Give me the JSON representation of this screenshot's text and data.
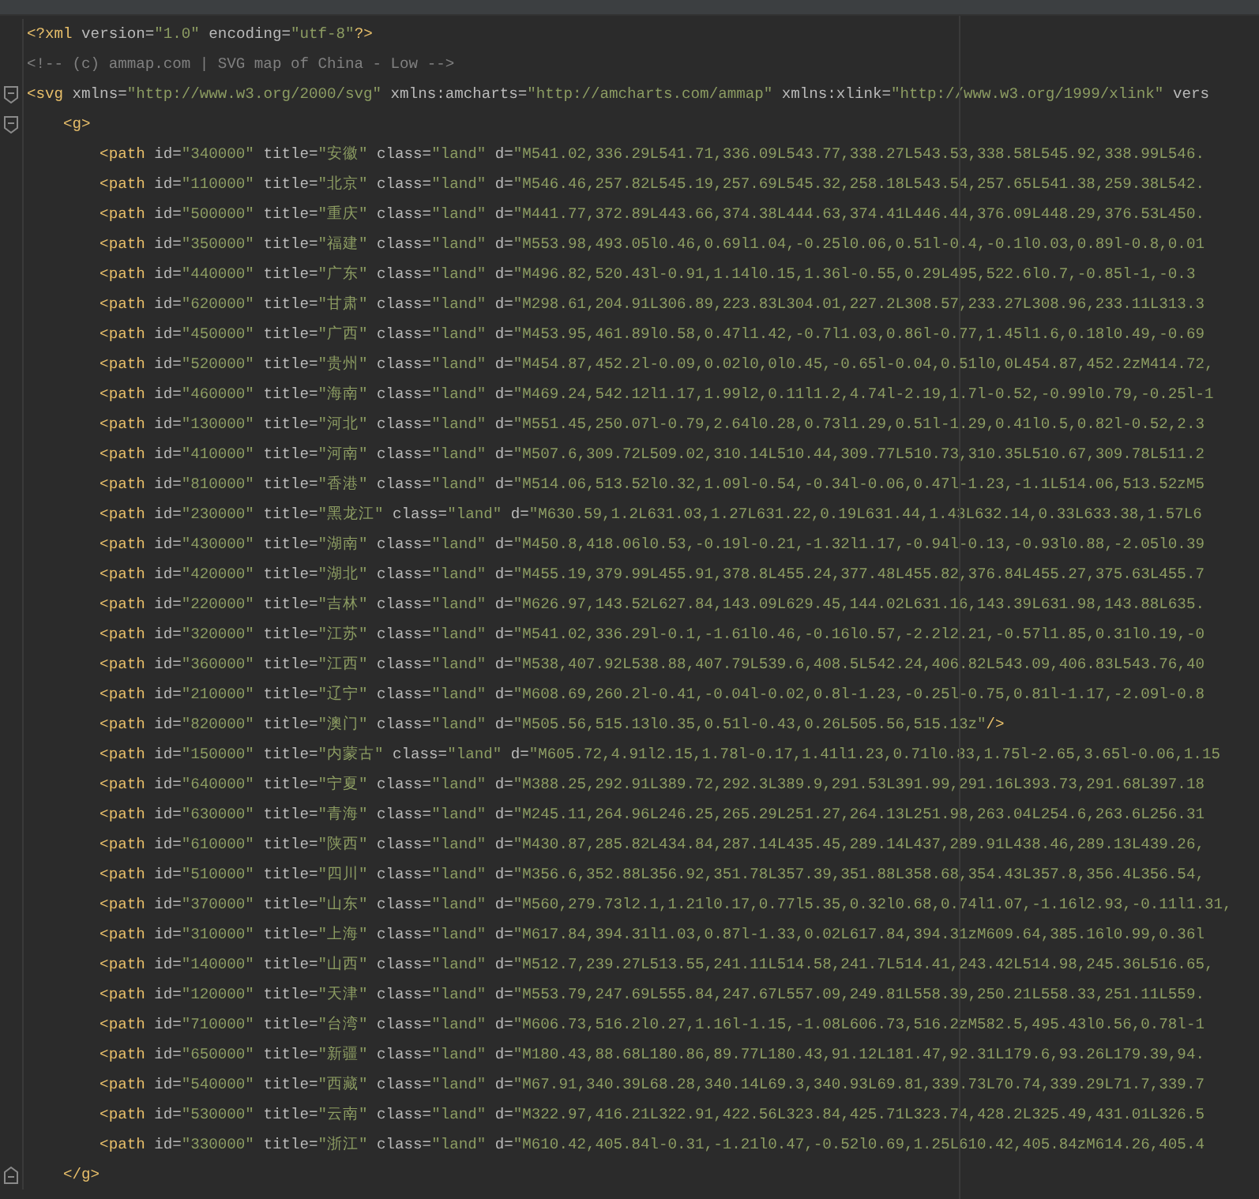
{
  "editor": {
    "lines": [
      {
        "tokens": [
          {
            "kind": "tag",
            "text": "<?xml"
          },
          {
            "kind": "attr",
            "text": " version="
          },
          {
            "kind": "value",
            "text": "\"1.0\""
          },
          {
            "kind": "attr",
            "text": " encoding="
          },
          {
            "kind": "value",
            "text": "\"utf-8\""
          },
          {
            "kind": "tag",
            "text": "?>"
          }
        ]
      },
      {
        "tokens": [
          {
            "kind": "comment",
            "text": "<!-- (c) ammap.com | SVG map of China - Low -->"
          }
        ]
      },
      {
        "kind": "fold_start",
        "tokens": [
          {
            "kind": "tag",
            "text": "<svg"
          },
          {
            "kind": "attr",
            "text": " xmlns="
          },
          {
            "kind": "value",
            "text": "\"http://www.w3.org/2000/svg\""
          },
          {
            "kind": "attr",
            "text": " xmlns:amcharts="
          },
          {
            "kind": "value",
            "text": "\"http://amcharts.com/ammap\""
          },
          {
            "kind": "attr",
            "text": " xmlns:xlink="
          },
          {
            "kind": "value",
            "text": "\"http://www.w3.org/1999/xlink\""
          },
          {
            "kind": "attr",
            "text": " vers"
          }
        ]
      },
      {
        "kind": "fold_start",
        "tokens": [
          {
            "kind": "tag",
            "text": "    <g>"
          }
        ]
      },
      {
        "tokens": [
          {
            "kind": "tag",
            "text": "        <path"
          },
          {
            "kind": "attr",
            "text": " id="
          },
          {
            "kind": "value",
            "text": "\"340000\""
          },
          {
            "kind": "attr",
            "text": " title="
          },
          {
            "kind": "value",
            "text": "\"安徽\""
          },
          {
            "kind": "attr",
            "text": " class="
          },
          {
            "kind": "value",
            "text": "\"land\""
          },
          {
            "kind": "attr",
            "text": " d="
          },
          {
            "kind": "value",
            "text": "\"M541.02,336.29L541.71,336.09L543.77,338.27L543.53,338.58L545.92,338.99L546."
          }
        ]
      },
      {
        "tokens": [
          {
            "kind": "tag",
            "text": "        <path"
          },
          {
            "kind": "attr",
            "text": " id="
          },
          {
            "kind": "value",
            "text": "\"110000\""
          },
          {
            "kind": "attr",
            "text": " title="
          },
          {
            "kind": "value",
            "text": "\"北京\""
          },
          {
            "kind": "attr",
            "text": " class="
          },
          {
            "kind": "value",
            "text": "\"land\""
          },
          {
            "kind": "attr",
            "text": " d="
          },
          {
            "kind": "value",
            "text": "\"M546.46,257.82L545.19,257.69L545.32,258.18L543.54,257.65L541.38,259.38L542."
          }
        ]
      },
      {
        "tokens": [
          {
            "kind": "tag",
            "text": "        <path"
          },
          {
            "kind": "attr",
            "text": " id="
          },
          {
            "kind": "value",
            "text": "\"500000\""
          },
          {
            "kind": "attr",
            "text": " title="
          },
          {
            "kind": "value",
            "text": "\"重庆\""
          },
          {
            "kind": "attr",
            "text": " class="
          },
          {
            "kind": "value",
            "text": "\"land\""
          },
          {
            "kind": "attr",
            "text": " d="
          },
          {
            "kind": "value",
            "text": "\"M441.77,372.89L443.66,374.38L444.63,374.41L446.44,376.09L448.29,376.53L450."
          }
        ]
      },
      {
        "tokens": [
          {
            "kind": "tag",
            "text": "        <path"
          },
          {
            "kind": "attr",
            "text": " id="
          },
          {
            "kind": "value",
            "text": "\"350000\""
          },
          {
            "kind": "attr",
            "text": " title="
          },
          {
            "kind": "value",
            "text": "\"福建\""
          },
          {
            "kind": "attr",
            "text": " class="
          },
          {
            "kind": "value",
            "text": "\"land\""
          },
          {
            "kind": "attr",
            "text": " d="
          },
          {
            "kind": "value",
            "text": "\"M553.98,493.05l0.46,0.69l1.04,-0.25l0.06,0.51l-0.4,-0.1l0.03,0.89l-0.8,0.01"
          }
        ]
      },
      {
        "tokens": [
          {
            "kind": "tag",
            "text": "        <path"
          },
          {
            "kind": "attr",
            "text": " id="
          },
          {
            "kind": "value",
            "text": "\"440000\""
          },
          {
            "kind": "attr",
            "text": " title="
          },
          {
            "kind": "value",
            "text": "\"广东\""
          },
          {
            "kind": "attr",
            "text": " class="
          },
          {
            "kind": "value",
            "text": "\"land\""
          },
          {
            "kind": "attr",
            "text": " d="
          },
          {
            "kind": "value",
            "text": "\"M496.82,520.43l-0.91,1.14l0.15,1.36l-0.55,0.29L495,522.6l0.7,-0.85l-1,-0.3"
          }
        ]
      },
      {
        "tokens": [
          {
            "kind": "tag",
            "text": "        <path"
          },
          {
            "kind": "attr",
            "text": " id="
          },
          {
            "kind": "value",
            "text": "\"620000\""
          },
          {
            "kind": "attr",
            "text": " title="
          },
          {
            "kind": "value",
            "text": "\"甘肃\""
          },
          {
            "kind": "attr",
            "text": " class="
          },
          {
            "kind": "value",
            "text": "\"land\""
          },
          {
            "kind": "attr",
            "text": " d="
          },
          {
            "kind": "value",
            "text": "\"M298.61,204.91L306.89,223.83L304.01,227.2L308.57,233.27L308.96,233.11L313.3"
          }
        ]
      },
      {
        "tokens": [
          {
            "kind": "tag",
            "text": "        <path"
          },
          {
            "kind": "attr",
            "text": " id="
          },
          {
            "kind": "value",
            "text": "\"450000\""
          },
          {
            "kind": "attr",
            "text": " title="
          },
          {
            "kind": "value",
            "text": "\"广西\""
          },
          {
            "kind": "attr",
            "text": " class="
          },
          {
            "kind": "value",
            "text": "\"land\""
          },
          {
            "kind": "attr",
            "text": " d="
          },
          {
            "kind": "value",
            "text": "\"M453.95,461.89l0.58,0.47l1.42,-0.7l1.03,0.86l-0.77,1.45l1.6,0.18l0.49,-0.69"
          }
        ]
      },
      {
        "tokens": [
          {
            "kind": "tag",
            "text": "        <path"
          },
          {
            "kind": "attr",
            "text": " id="
          },
          {
            "kind": "value",
            "text": "\"520000\""
          },
          {
            "kind": "attr",
            "text": " title="
          },
          {
            "kind": "value",
            "text": "\"贵州\""
          },
          {
            "kind": "attr",
            "text": " class="
          },
          {
            "kind": "value",
            "text": "\"land\""
          },
          {
            "kind": "attr",
            "text": " d="
          },
          {
            "kind": "value",
            "text": "\"M454.87,452.2l-0.09,0.02l0,0l0.45,-0.65l-0.04,0.51l0,0L454.87,452.2zM414.72,"
          }
        ]
      },
      {
        "tokens": [
          {
            "kind": "tag",
            "text": "        <path"
          },
          {
            "kind": "attr",
            "text": " id="
          },
          {
            "kind": "value",
            "text": "\"460000\""
          },
          {
            "kind": "attr",
            "text": " title="
          },
          {
            "kind": "value",
            "text": "\"海南\""
          },
          {
            "kind": "attr",
            "text": " class="
          },
          {
            "kind": "value",
            "text": "\"land\""
          },
          {
            "kind": "attr",
            "text": " d="
          },
          {
            "kind": "value",
            "text": "\"M469.24,542.12l1.17,1.99l2,0.11l1.2,4.74l-2.19,1.7l-0.52,-0.99l0.79,-0.25l-1"
          }
        ]
      },
      {
        "tokens": [
          {
            "kind": "tag",
            "text": "        <path"
          },
          {
            "kind": "attr",
            "text": " id="
          },
          {
            "kind": "value",
            "text": "\"130000\""
          },
          {
            "kind": "attr",
            "text": " title="
          },
          {
            "kind": "value",
            "text": "\"河北\""
          },
          {
            "kind": "attr",
            "text": " class="
          },
          {
            "kind": "value",
            "text": "\"land\""
          },
          {
            "kind": "attr",
            "text": " d="
          },
          {
            "kind": "value",
            "text": "\"M551.45,250.07l-0.79,2.64l0.28,0.73l1.29,0.51l-1.29,0.41l0.5,0.82l-0.52,2.3"
          }
        ]
      },
      {
        "tokens": [
          {
            "kind": "tag",
            "text": "        <path"
          },
          {
            "kind": "attr",
            "text": " id="
          },
          {
            "kind": "value",
            "text": "\"410000\""
          },
          {
            "kind": "attr",
            "text": " title="
          },
          {
            "kind": "value",
            "text": "\"河南\""
          },
          {
            "kind": "attr",
            "text": " class="
          },
          {
            "kind": "value",
            "text": "\"land\""
          },
          {
            "kind": "attr",
            "text": " d="
          },
          {
            "kind": "value",
            "text": "\"M507.6,309.72L509.02,310.14L510.44,309.77L510.73,310.35L510.67,309.78L511.2"
          }
        ]
      },
      {
        "tokens": [
          {
            "kind": "tag",
            "text": "        <path"
          },
          {
            "kind": "attr",
            "text": " id="
          },
          {
            "kind": "value",
            "text": "\"810000\""
          },
          {
            "kind": "attr",
            "text": " title="
          },
          {
            "kind": "value",
            "text": "\"香港\""
          },
          {
            "kind": "attr",
            "text": " class="
          },
          {
            "kind": "value",
            "text": "\"land\""
          },
          {
            "kind": "attr",
            "text": " d="
          },
          {
            "kind": "value",
            "text": "\"M514.06,513.52l0.32,1.09l-0.54,-0.34l-0.06,0.47l-1.23,-1.1L514.06,513.52zM5"
          }
        ]
      },
      {
        "tokens": [
          {
            "kind": "tag",
            "text": "        <path"
          },
          {
            "kind": "attr",
            "text": " id="
          },
          {
            "kind": "value",
            "text": "\"230000\""
          },
          {
            "kind": "attr",
            "text": " title="
          },
          {
            "kind": "value",
            "text": "\"黑龙江\""
          },
          {
            "kind": "attr",
            "text": " class="
          },
          {
            "kind": "value",
            "text": "\"land\""
          },
          {
            "kind": "attr",
            "text": " d="
          },
          {
            "kind": "value",
            "text": "\"M630.59,1.2L631.03,1.27L631.22,0.19L631.44,1.43L632.14,0.33L633.38,1.57L6"
          }
        ]
      },
      {
        "tokens": [
          {
            "kind": "tag",
            "text": "        <path"
          },
          {
            "kind": "attr",
            "text": " id="
          },
          {
            "kind": "value",
            "text": "\"430000\""
          },
          {
            "kind": "attr",
            "text": " title="
          },
          {
            "kind": "value",
            "text": "\"湖南\""
          },
          {
            "kind": "attr",
            "text": " class="
          },
          {
            "kind": "value",
            "text": "\"land\""
          },
          {
            "kind": "attr",
            "text": " d="
          },
          {
            "kind": "value",
            "text": "\"M450.8,418.06l0.53,-0.19l-0.21,-1.32l1.17,-0.94l-0.13,-0.93l0.88,-2.05l0.39"
          }
        ]
      },
      {
        "tokens": [
          {
            "kind": "tag",
            "text": "        <path"
          },
          {
            "kind": "attr",
            "text": " id="
          },
          {
            "kind": "value",
            "text": "\"420000\""
          },
          {
            "kind": "attr",
            "text": " title="
          },
          {
            "kind": "value",
            "text": "\"湖北\""
          },
          {
            "kind": "attr",
            "text": " class="
          },
          {
            "kind": "value",
            "text": "\"land\""
          },
          {
            "kind": "attr",
            "text": " d="
          },
          {
            "kind": "value",
            "text": "\"M455.19,379.99L455.91,378.8L455.24,377.48L455.82,376.84L455.27,375.63L455.7"
          }
        ]
      },
      {
        "tokens": [
          {
            "kind": "tag",
            "text": "        <path"
          },
          {
            "kind": "attr",
            "text": " id="
          },
          {
            "kind": "value",
            "text": "\"220000\""
          },
          {
            "kind": "attr",
            "text": " title="
          },
          {
            "kind": "value",
            "text": "\"吉林\""
          },
          {
            "kind": "attr",
            "text": " class="
          },
          {
            "kind": "value",
            "text": "\"land\""
          },
          {
            "kind": "attr",
            "text": " d="
          },
          {
            "kind": "value",
            "text": "\"M626.97,143.52L627.84,143.09L629.45,144.02L631.16,143.39L631.98,143.88L635."
          }
        ]
      },
      {
        "tokens": [
          {
            "kind": "tag",
            "text": "        <path"
          },
          {
            "kind": "attr",
            "text": " id="
          },
          {
            "kind": "value",
            "text": "\"320000\""
          },
          {
            "kind": "attr",
            "text": " title="
          },
          {
            "kind": "value",
            "text": "\"江苏\""
          },
          {
            "kind": "attr",
            "text": " class="
          },
          {
            "kind": "value",
            "text": "\"land\""
          },
          {
            "kind": "attr",
            "text": " d="
          },
          {
            "kind": "value",
            "text": "\"M541.02,336.29l-0.1,-1.61l0.46,-0.16l0.57,-2.2l2.21,-0.57l1.85,0.31l0.19,-0"
          }
        ]
      },
      {
        "tokens": [
          {
            "kind": "tag",
            "text": "        <path"
          },
          {
            "kind": "attr",
            "text": " id="
          },
          {
            "kind": "value",
            "text": "\"360000\""
          },
          {
            "kind": "attr",
            "text": " title="
          },
          {
            "kind": "value",
            "text": "\"江西\""
          },
          {
            "kind": "attr",
            "text": " class="
          },
          {
            "kind": "value",
            "text": "\"land\""
          },
          {
            "kind": "attr",
            "text": " d="
          },
          {
            "kind": "value",
            "text": "\"M538,407.92L538.88,407.79L539.6,408.5L542.24,406.82L543.09,406.83L543.76,40"
          }
        ]
      },
      {
        "tokens": [
          {
            "kind": "tag",
            "text": "        <path"
          },
          {
            "kind": "attr",
            "text": " id="
          },
          {
            "kind": "value",
            "text": "\"210000\""
          },
          {
            "kind": "attr",
            "text": " title="
          },
          {
            "kind": "value",
            "text": "\"辽宁\""
          },
          {
            "kind": "attr",
            "text": " class="
          },
          {
            "kind": "value",
            "text": "\"land\""
          },
          {
            "kind": "attr",
            "text": " d="
          },
          {
            "kind": "value",
            "text": "\"M608.69,260.2l-0.41,-0.04l-0.02,0.8l-1.23,-0.25l-0.75,0.81l-1.17,-2.09l-0.8"
          }
        ]
      },
      {
        "tokens": [
          {
            "kind": "tag",
            "text": "        <path"
          },
          {
            "kind": "attr",
            "text": " id="
          },
          {
            "kind": "value",
            "text": "\"820000\""
          },
          {
            "kind": "attr",
            "text": " title="
          },
          {
            "kind": "value",
            "text": "\"澳门\""
          },
          {
            "kind": "attr",
            "text": " class="
          },
          {
            "kind": "value",
            "text": "\"land\""
          },
          {
            "kind": "attr",
            "text": " d="
          },
          {
            "kind": "value",
            "text": "\"M505.56,515.13l0.35,0.51l-0.43,0.26L505.56,515.13z\""
          },
          {
            "kind": "tag",
            "text": "/>"
          }
        ]
      },
      {
        "tokens": [
          {
            "kind": "tag",
            "text": "        <path"
          },
          {
            "kind": "attr",
            "text": " id="
          },
          {
            "kind": "value",
            "text": "\"150000\""
          },
          {
            "kind": "attr",
            "text": " title="
          },
          {
            "kind": "value",
            "text": "\"内蒙古\""
          },
          {
            "kind": "attr",
            "text": " class="
          },
          {
            "kind": "value",
            "text": "\"land\""
          },
          {
            "kind": "attr",
            "text": " d="
          },
          {
            "kind": "value",
            "text": "\"M605.72,4.91l2.15,1.78l-0.17,1.41l1.23,0.71l0.83,1.75l-2.65,3.65l-0.06,1.15"
          }
        ]
      },
      {
        "tokens": [
          {
            "kind": "tag",
            "text": "        <path"
          },
          {
            "kind": "attr",
            "text": " id="
          },
          {
            "kind": "value",
            "text": "\"640000\""
          },
          {
            "kind": "attr",
            "text": " title="
          },
          {
            "kind": "value",
            "text": "\"宁夏\""
          },
          {
            "kind": "attr",
            "text": " class="
          },
          {
            "kind": "value",
            "text": "\"land\""
          },
          {
            "kind": "attr",
            "text": " d="
          },
          {
            "kind": "value",
            "text": "\"M388.25,292.91L389.72,292.3L389.9,291.53L391.99,291.16L393.73,291.68L397.18"
          }
        ]
      },
      {
        "tokens": [
          {
            "kind": "tag",
            "text": "        <path"
          },
          {
            "kind": "attr",
            "text": " id="
          },
          {
            "kind": "value",
            "text": "\"630000\""
          },
          {
            "kind": "attr",
            "text": " title="
          },
          {
            "kind": "value",
            "text": "\"青海\""
          },
          {
            "kind": "attr",
            "text": " class="
          },
          {
            "kind": "value",
            "text": "\"land\""
          },
          {
            "kind": "attr",
            "text": " d="
          },
          {
            "kind": "value",
            "text": "\"M245.11,264.96L246.25,265.29L251.27,264.13L251.98,263.04L254.6,263.6L256.31"
          }
        ]
      },
      {
        "tokens": [
          {
            "kind": "tag",
            "text": "        <path"
          },
          {
            "kind": "attr",
            "text": " id="
          },
          {
            "kind": "value",
            "text": "\"610000\""
          },
          {
            "kind": "attr",
            "text": " title="
          },
          {
            "kind": "value",
            "text": "\"陕西\""
          },
          {
            "kind": "attr",
            "text": " class="
          },
          {
            "kind": "value",
            "text": "\"land\""
          },
          {
            "kind": "attr",
            "text": " d="
          },
          {
            "kind": "value",
            "text": "\"M430.87,285.82L434.84,287.14L435.45,289.14L437,289.91L438.46,289.13L439.26,"
          }
        ]
      },
      {
        "tokens": [
          {
            "kind": "tag",
            "text": "        <path"
          },
          {
            "kind": "attr",
            "text": " id="
          },
          {
            "kind": "value",
            "text": "\"510000\""
          },
          {
            "kind": "attr",
            "text": " title="
          },
          {
            "kind": "value",
            "text": "\"四川\""
          },
          {
            "kind": "attr",
            "text": " class="
          },
          {
            "kind": "value",
            "text": "\"land\""
          },
          {
            "kind": "attr",
            "text": " d="
          },
          {
            "kind": "value",
            "text": "\"M356.6,352.88L356.92,351.78L357.39,351.88L358.68,354.43L357.8,356.4L356.54,"
          }
        ]
      },
      {
        "tokens": [
          {
            "kind": "tag",
            "text": "        <path"
          },
          {
            "kind": "attr",
            "text": " id="
          },
          {
            "kind": "value",
            "text": "\"370000\""
          },
          {
            "kind": "attr",
            "text": " title="
          },
          {
            "kind": "value",
            "text": "\"山东\""
          },
          {
            "kind": "attr",
            "text": " class="
          },
          {
            "kind": "value",
            "text": "\"land\""
          },
          {
            "kind": "attr",
            "text": " d="
          },
          {
            "kind": "value",
            "text": "\"M560,279.73l2.1,1.21l0.17,0.77l5.35,0.32l0.68,0.74l1.07,-1.16l2.93,-0.11l1.31,"
          }
        ]
      },
      {
        "tokens": [
          {
            "kind": "tag",
            "text": "        <path"
          },
          {
            "kind": "attr",
            "text": " id="
          },
          {
            "kind": "value",
            "text": "\"310000\""
          },
          {
            "kind": "attr",
            "text": " title="
          },
          {
            "kind": "value",
            "text": "\"上海\""
          },
          {
            "kind": "attr",
            "text": " class="
          },
          {
            "kind": "value",
            "text": "\"land\""
          },
          {
            "kind": "attr",
            "text": " d="
          },
          {
            "kind": "value",
            "text": "\"M617.84,394.31l1.03,0.87l-1.33,0.02L617.84,394.31zM609.64,385.16l0.99,0.36l"
          }
        ]
      },
      {
        "tokens": [
          {
            "kind": "tag",
            "text": "        <path"
          },
          {
            "kind": "attr",
            "text": " id="
          },
          {
            "kind": "value",
            "text": "\"140000\""
          },
          {
            "kind": "attr",
            "text": " title="
          },
          {
            "kind": "value",
            "text": "\"山西\""
          },
          {
            "kind": "attr",
            "text": " class="
          },
          {
            "kind": "value",
            "text": "\"land\""
          },
          {
            "kind": "attr",
            "text": " d="
          },
          {
            "kind": "value",
            "text": "\"M512.7,239.27L513.55,241.11L514.58,241.7L514.41,243.42L514.98,245.36L516.65,"
          }
        ]
      },
      {
        "tokens": [
          {
            "kind": "tag",
            "text": "        <path"
          },
          {
            "kind": "attr",
            "text": " id="
          },
          {
            "kind": "value",
            "text": "\"120000\""
          },
          {
            "kind": "attr",
            "text": " title="
          },
          {
            "kind": "value",
            "text": "\"天津\""
          },
          {
            "kind": "attr",
            "text": " class="
          },
          {
            "kind": "value",
            "text": "\"land\""
          },
          {
            "kind": "attr",
            "text": " d="
          },
          {
            "kind": "value",
            "text": "\"M553.79,247.69L555.84,247.67L557.09,249.81L558.39,250.21L558.33,251.11L559."
          }
        ]
      },
      {
        "tokens": [
          {
            "kind": "tag",
            "text": "        <path"
          },
          {
            "kind": "attr",
            "text": " id="
          },
          {
            "kind": "value",
            "text": "\"710000\""
          },
          {
            "kind": "attr",
            "text": " title="
          },
          {
            "kind": "value",
            "text": "\"台湾\""
          },
          {
            "kind": "attr",
            "text": " class="
          },
          {
            "kind": "value",
            "text": "\"land\""
          },
          {
            "kind": "attr",
            "text": " d="
          },
          {
            "kind": "value",
            "text": "\"M606.73,516.2l0.27,1.16l-1.15,-1.08L606.73,516.2zM582.5,495.43l0.56,0.78l-1"
          }
        ]
      },
      {
        "tokens": [
          {
            "kind": "tag",
            "text": "        <path"
          },
          {
            "kind": "attr",
            "text": " id="
          },
          {
            "kind": "value",
            "text": "\"650000\""
          },
          {
            "kind": "attr",
            "text": " title="
          },
          {
            "kind": "value",
            "text": "\"新疆\""
          },
          {
            "kind": "attr",
            "text": " class="
          },
          {
            "kind": "value",
            "text": "\"land\""
          },
          {
            "kind": "attr",
            "text": " d="
          },
          {
            "kind": "value",
            "text": "\"M180.43,88.68L180.86,89.77L180.43,91.12L181.47,92.31L179.6,93.26L179.39,94."
          }
        ]
      },
      {
        "tokens": [
          {
            "kind": "tag",
            "text": "        <path"
          },
          {
            "kind": "attr",
            "text": " id="
          },
          {
            "kind": "value",
            "text": "\"540000\""
          },
          {
            "kind": "attr",
            "text": " title="
          },
          {
            "kind": "value",
            "text": "\"西藏\""
          },
          {
            "kind": "attr",
            "text": " class="
          },
          {
            "kind": "value",
            "text": "\"land\""
          },
          {
            "kind": "attr",
            "text": " d="
          },
          {
            "kind": "value",
            "text": "\"M67.91,340.39L68.28,340.14L69.3,340.93L69.81,339.73L70.74,339.29L71.7,339.7"
          }
        ]
      },
      {
        "tokens": [
          {
            "kind": "tag",
            "text": "        <path"
          },
          {
            "kind": "attr",
            "text": " id="
          },
          {
            "kind": "value",
            "text": "\"530000\""
          },
          {
            "kind": "attr",
            "text": " title="
          },
          {
            "kind": "value",
            "text": "\"云南\""
          },
          {
            "kind": "attr",
            "text": " class="
          },
          {
            "kind": "value",
            "text": "\"land\""
          },
          {
            "kind": "attr",
            "text": " d="
          },
          {
            "kind": "value",
            "text": "\"M322.97,416.21L322.91,422.56L323.84,425.71L323.74,428.2L325.49,431.01L326.5"
          }
        ]
      },
      {
        "tokens": [
          {
            "kind": "tag",
            "text": "        <path"
          },
          {
            "kind": "attr",
            "text": " id="
          },
          {
            "kind": "value",
            "text": "\"330000\""
          },
          {
            "kind": "attr",
            "text": " title="
          },
          {
            "kind": "value",
            "text": "\"浙江\""
          },
          {
            "kind": "attr",
            "text": " class="
          },
          {
            "kind": "value",
            "text": "\"land\""
          },
          {
            "kind": "attr",
            "text": " d="
          },
          {
            "kind": "value",
            "text": "\"M610.42,405.84l-0.31,-1.21l0.47,-0.52l0.69,1.25L610.42,405.84zM614.26,405.4"
          }
        ]
      },
      {
        "kind": "fold_end",
        "tokens": [
          {
            "kind": "tag",
            "text": "    </g>"
          }
        ]
      }
    ]
  }
}
